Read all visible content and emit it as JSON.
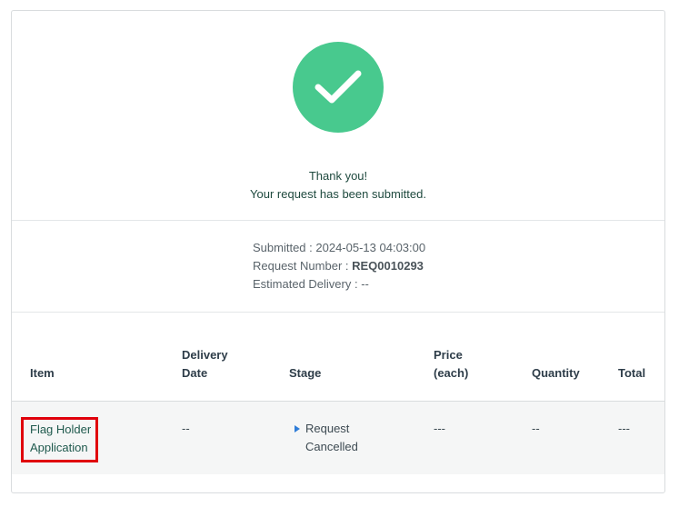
{
  "confirmation": {
    "icon": "checkmark-icon",
    "icon_color": "#48c98e",
    "line1": "Thank you!",
    "line2": "Your request has been submitted."
  },
  "details": {
    "submitted_label": "Submitted :",
    "submitted_value": "2024-05-13 04:03:00",
    "request_number_label": "Request Number :",
    "request_number_value": "REQ0010293",
    "estimated_delivery_label": "Estimated Delivery :",
    "estimated_delivery_value": "--"
  },
  "table": {
    "headers": {
      "item": "Item",
      "delivery_date_1": "Delivery",
      "delivery_date_2": "Date",
      "stage": "Stage",
      "price_1": "Price",
      "price_2": "(each)",
      "quantity": "Quantity",
      "total": "Total"
    },
    "rows": [
      {
        "item_line1": "Flag Holder",
        "item_line2": "Application",
        "delivery_date": "--",
        "stage_line1": "Request",
        "stage_line2": "Cancelled",
        "price": "---",
        "quantity": "--",
        "total": "---"
      }
    ]
  },
  "colors": {
    "highlight_border": "#e0000b",
    "stage_arrow": "#2f7dd8"
  }
}
